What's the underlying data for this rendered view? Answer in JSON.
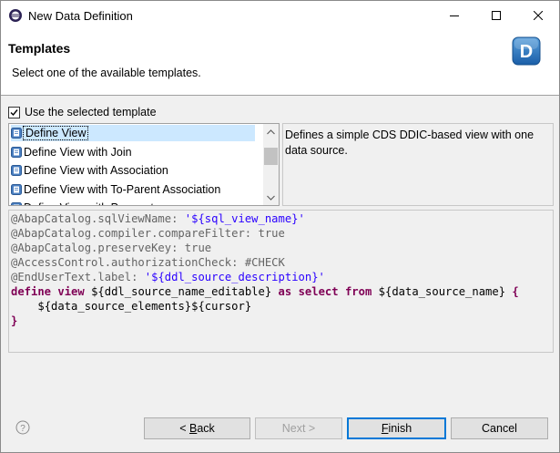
{
  "window": {
    "title": "New Data Definition"
  },
  "banner": {
    "title": "Templates",
    "description": "Select one of the available templates.",
    "logo_letter": "D"
  },
  "options": {
    "use_template_label": "Use the selected template",
    "use_template_checked": true
  },
  "templates": {
    "items": [
      {
        "label": "Define View",
        "selected": true
      },
      {
        "label": "Define View with Join",
        "selected": false
      },
      {
        "label": "Define View with Association",
        "selected": false
      },
      {
        "label": "Define View with To-Parent Association",
        "selected": false
      },
      {
        "label": "Define View with Parameters",
        "selected": false
      }
    ],
    "description": "Defines a simple CDS DDIC-based view with one data source."
  },
  "code": {
    "lines": [
      "@AbapCatalog.sqlViewName: '${sql_view_name}'",
      "@AbapCatalog.compiler.compareFilter: true",
      "@AbapCatalog.preserveKey: true",
      "@AccessControl.authorizationCheck: #CHECK",
      "@EndUserText.label: '${ddl_source_description}'",
      "define view ${ddl_source_name_editable} as select from ${data_source_name} {",
      "    ${data_source_elements}${cursor}",
      "}"
    ]
  },
  "buttons": {
    "back": "< Back",
    "back_mnemonic": "B",
    "next": "Next >",
    "finish": "Finish",
    "finish_mnemonic": "F",
    "cancel": "Cancel",
    "back_enabled": true,
    "next_enabled": false
  },
  "colors": {
    "accent": "#0078d7",
    "selection": "#cce8ff",
    "keyword": "#7f0055",
    "annotation": "#646464",
    "string": "#2a00ff",
    "logo_blue": "#1e73be"
  },
  "icons": {
    "app": "eclipse-icon",
    "template": "template-icon",
    "help": "help-icon",
    "logo": "data-definition-logo"
  }
}
